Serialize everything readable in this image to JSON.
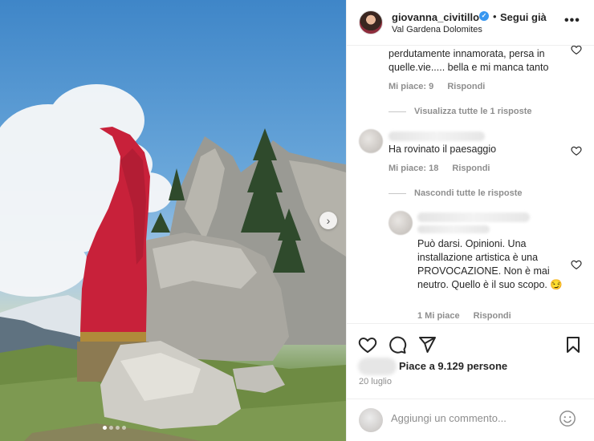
{
  "post": {
    "username": "giovanna_civitillo",
    "follow_label": "Segui già",
    "separator": "•",
    "location": "Val Gardena Dolomites",
    "more_icon": "more-horizontal-icon",
    "more_glyph": "•••"
  },
  "photo": {
    "next_icon": "chevron-right-icon",
    "next_glyph": "›",
    "carousel_count": 4,
    "carousel_active": 1
  },
  "comments": [
    {
      "text": "perdutamente innamorata, persa in quelle.vie..... bella e mi manca tanto",
      "likes": "Mi piace: 9",
      "reply": "Rispondi",
      "thread_label": "Visualizza tutte le 1 risposte"
    },
    {
      "text": "Ha rovinato il paesaggio",
      "likes": "Mi piace: 18",
      "reply": "Rispondi",
      "thread_label": "Nascondi tutte le risposte"
    },
    {
      "text": "Può darsi. Opinioni. Una installazione artistica è una PROVOCAZIONE. Non è mai neutro. Quello è il suo scopo.",
      "emoji": "😏",
      "likes": "1 Mi piace",
      "reply": "Rispondi"
    }
  ],
  "actions": {
    "like_icon": "heart-icon",
    "comment_icon": "comment-icon",
    "share_icon": "paper-plane-icon",
    "save_icon": "bookmark-icon",
    "likes_text": "Piace a 9.129 persone",
    "date": "20 luglio"
  },
  "add_comment": {
    "placeholder": "Aggiungi un commento...",
    "emoji_icon": "smiley-icon"
  },
  "colors": {
    "text": "#262626",
    "muted": "#8e8e8e",
    "verified": "#3897f0",
    "sculpture_red": "#c8213a"
  }
}
